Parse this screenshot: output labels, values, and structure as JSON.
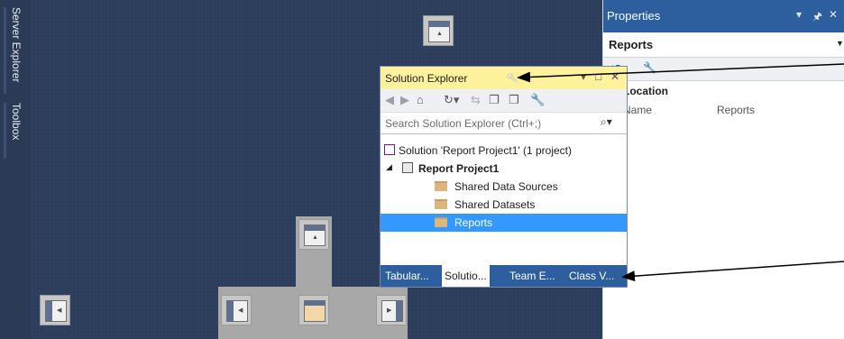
{
  "side_tabs": [
    "Server Explorer",
    "Toolbox"
  ],
  "properties": {
    "title": "Properties",
    "pin": "↓ □ ✕",
    "object": "Reports",
    "category": "Location",
    "row_name": "Name",
    "row_value": "Reports"
  },
  "solution_explorer": {
    "title": "Solution Explorer",
    "search_placeholder": "Search Solution Explorer (Ctrl+;)",
    "tree": {
      "solution": "Solution 'Report Project1' (1 project)",
      "project": "Report Project1",
      "items": [
        "Shared Data Sources",
        "Shared Datasets",
        "Reports"
      ]
    },
    "tabs": [
      "Tabular...",
      "Solutio...",
      "Team E...",
      "Class V..."
    ]
  },
  "colors": {
    "ide_bg": "#2d3e5d",
    "title_active": "#2d5e9e",
    "floating_title": "#fff29d",
    "selection": "#3399ff"
  }
}
